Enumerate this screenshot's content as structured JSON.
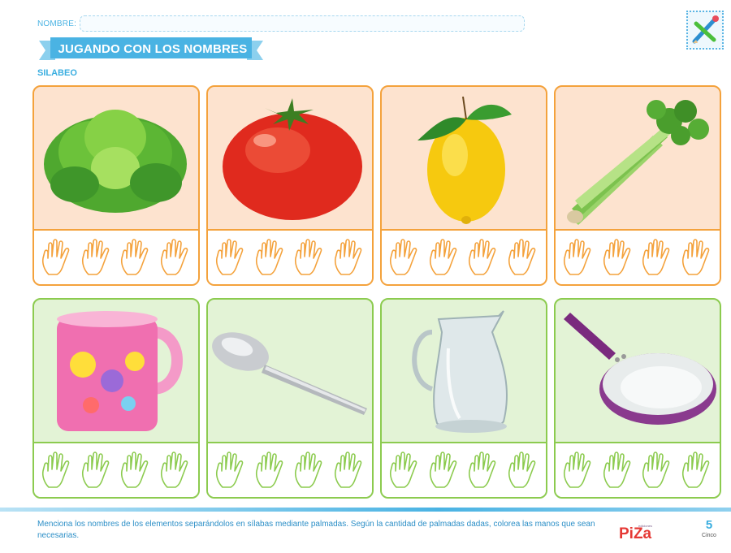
{
  "header": {
    "nombre_label": "NOMBRE:",
    "title": "JUGANDO CON LOS NOMBRES",
    "subtitle": "SILABEO",
    "accent_color": "#4ab3e3",
    "icon": "pencil-icon"
  },
  "cards": [
    {
      "item": "lettuce",
      "row_color": "#f4a23c",
      "hands": 4
    },
    {
      "item": "tomato",
      "row_color": "#f4a23c",
      "hands": 4
    },
    {
      "item": "lemon",
      "row_color": "#f4a23c",
      "hands": 4
    },
    {
      "item": "celery",
      "row_color": "#f4a23c",
      "hands": 4
    },
    {
      "item": "mug",
      "row_color": "#8ccb4f",
      "hands": 4
    },
    {
      "item": "spoon",
      "row_color": "#8ccb4f",
      "hands": 4
    },
    {
      "item": "pitcher",
      "row_color": "#8ccb4f",
      "hands": 4
    },
    {
      "item": "frying-pan",
      "row_color": "#8ccb4f",
      "hands": 4
    }
  ],
  "footer": {
    "instructions": "Menciona los nombres de los elementos separándolos en sílabas mediante palmadas. Según la cantidad de palmadas dadas, colorea las manos que sean necesarias.",
    "publisher_small": "ediciones",
    "publisher": "PiZa",
    "page_number": "5",
    "page_word": "Cinco"
  }
}
